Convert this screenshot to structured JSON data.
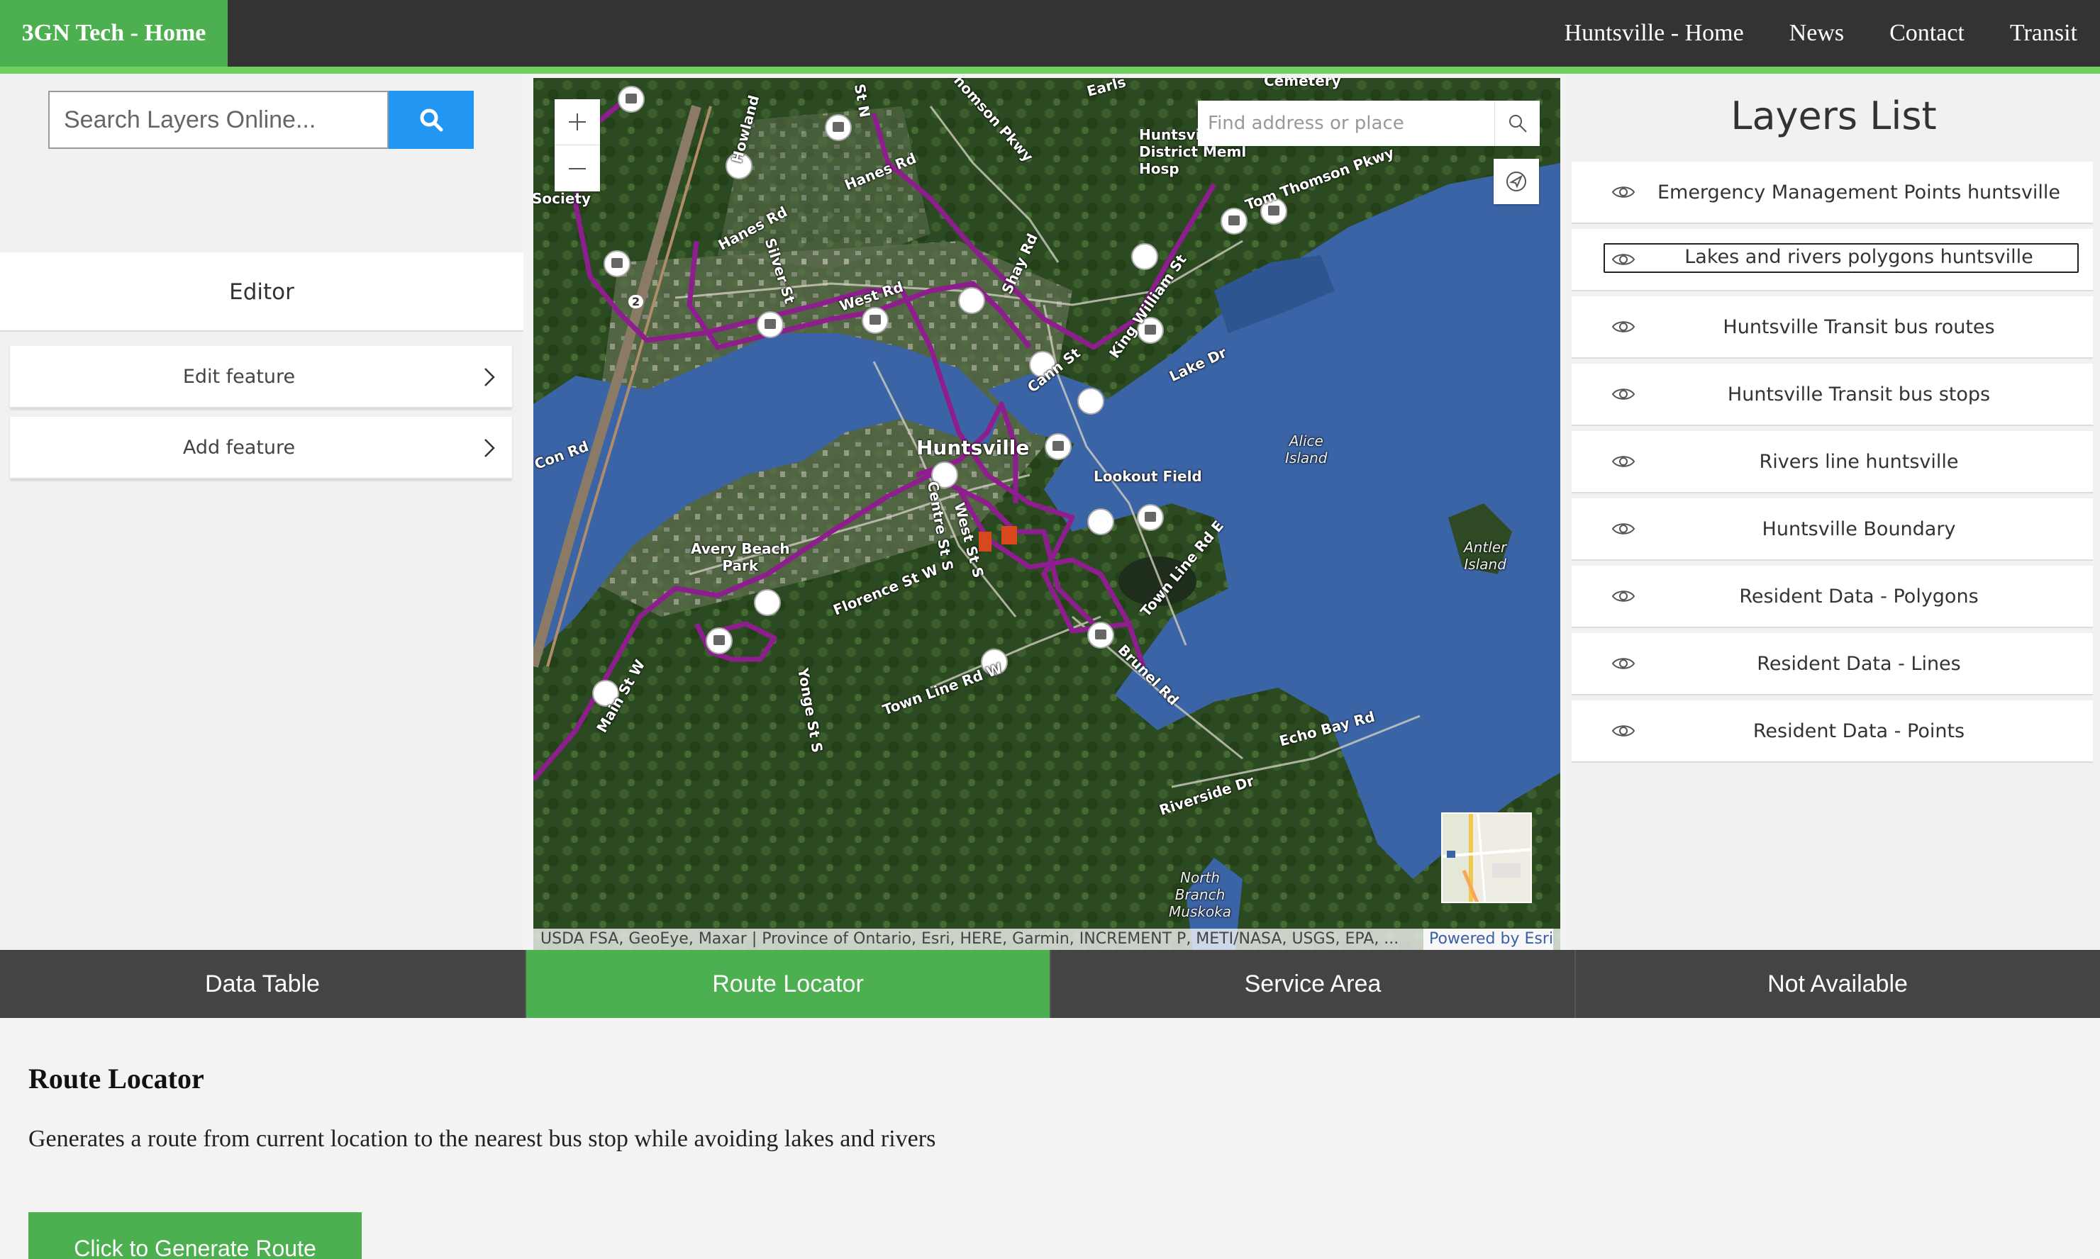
{
  "nav": {
    "brand": "3GN Tech - Home",
    "links": [
      "Huntsville - Home",
      "News",
      "Contact",
      "Transit"
    ]
  },
  "search": {
    "placeholder": "Search Layers Online..."
  },
  "editor": {
    "title": "Editor",
    "items": [
      "Edit feature",
      "Add feature"
    ]
  },
  "map": {
    "geocoder_placeholder": "Find address or place",
    "attribution": "USDA FSA, GeoEye, Maxar | Province of Ontario, Esri, HERE, Garmin, INCREMENT P, METI/NASA, USGS, EPA, ...",
    "powered_by": "Powered by Esri",
    "labels": {
      "huntsville": "Huntsville",
      "lookout_field": "Lookout Field",
      "alice_island": "Alice\nIsland",
      "antler_island": "Antler\nIsland",
      "avery_beach": "Avery Beach\nPark",
      "north_branch": "North\nBranch\nMuskoka",
      "west_rd": "West Rd",
      "hanes_rd": "Hanes Rd",
      "hanes_rd2": "Hanes Rd",
      "shay_rd": "Shay Rd",
      "cann_st": "Cann St",
      "king_william": "King William St",
      "lake_dr": "Lake Dr",
      "tom_thomson": "Tom Thomson Pkwy",
      "thomson_pkwy": "Thomson Pkwy",
      "florence": "Florence St W",
      "town_line_w": "Town Line Rd W",
      "town_line_e": "Town Line Rd E",
      "brunel": "Brunel Rd",
      "echo_bay": "Echo Bay Rd",
      "riverside": "Riverside Dr",
      "main_st": "Main St W",
      "yonge": "Yonge St S",
      "centre": "Centre St S",
      "west_st": "West St S",
      "silver": "Silver St",
      "howland": "Howland",
      "hospital": "Huntsville\nDistrict Meml\nHosp",
      "society": "Society",
      "con_rd": "Con Rd",
      "earls": "Earls",
      "cemetery": "Cemetery",
      "st_n": "St N",
      "route_2": "2"
    }
  },
  "layers": {
    "title": "Layers List",
    "items": [
      "Emergency Management Points huntsville",
      "Lakes and rivers polygons huntsville",
      "Huntsville Transit bus routes",
      "Huntsville Transit bus stops",
      "Rivers line huntsville",
      "Huntsville Boundary",
      "Resident Data - Polygons",
      "Resident Data - Lines",
      "Resident Data - Points"
    ],
    "selected_index": 1
  },
  "tabs": [
    "Data Table",
    "Route Locator",
    "Service Area",
    "Not Available"
  ],
  "active_tab": 1,
  "route": {
    "title": "Route Locator",
    "description": "Generates a route from current location to the nearest bus stop while avoiding lakes and rivers",
    "button": "Click to Generate Route"
  },
  "colors": {
    "nav_bg": "#333333",
    "accent_green": "#4caf50",
    "search_blue": "#2196f3",
    "bus_route": "#8e1e8e",
    "water": "#3b64a6"
  }
}
